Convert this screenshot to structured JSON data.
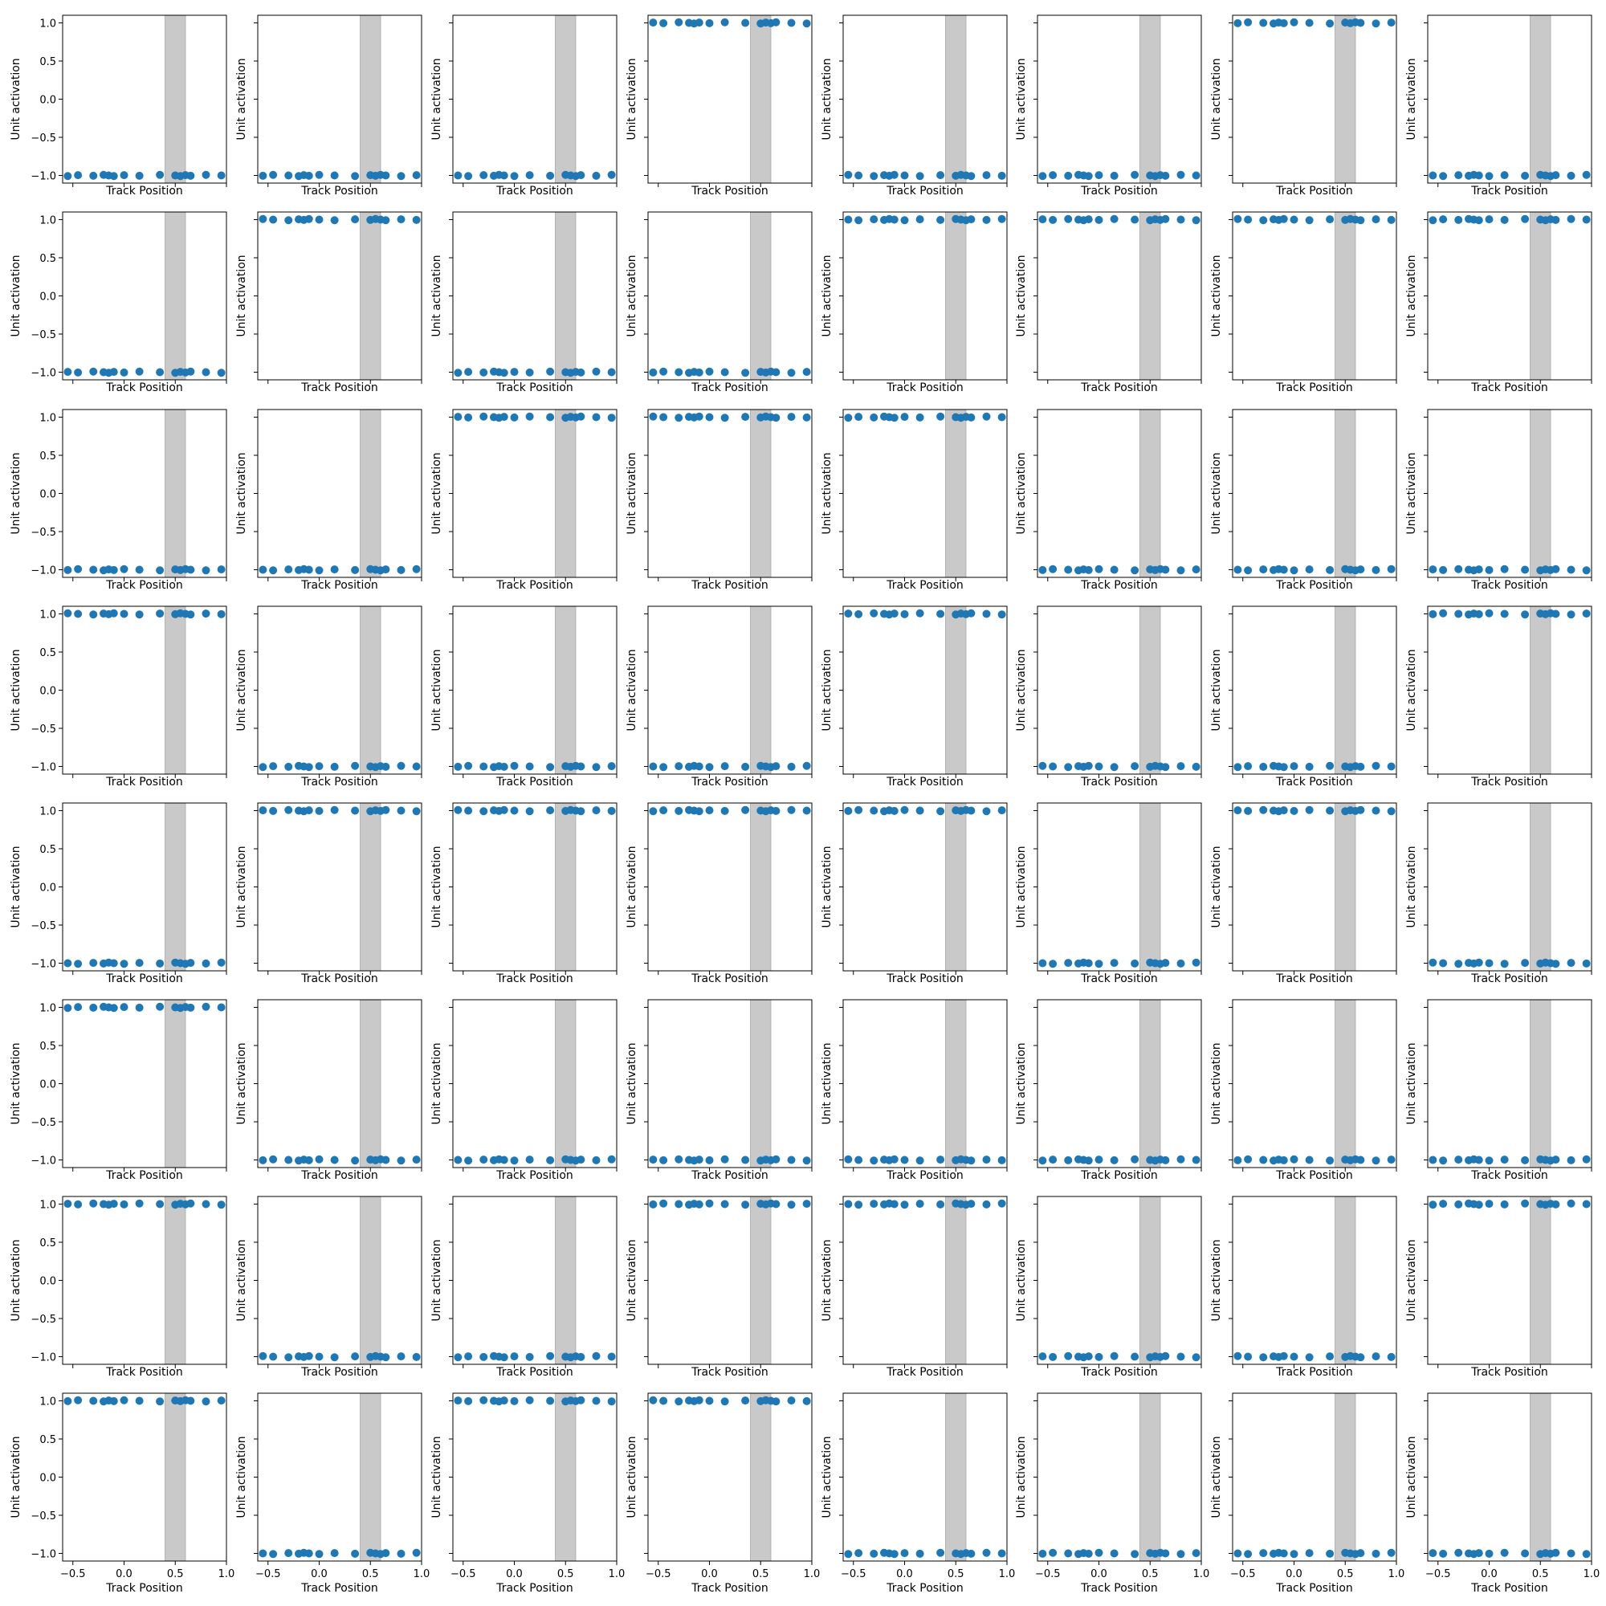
{
  "chart_data": {
    "type": "scatter",
    "layout": {
      "rows": 8,
      "cols": 8,
      "sharex": true,
      "sharey": true
    },
    "xlabel": "Track Position",
    "ylabel": "Unit activation",
    "xlim": [
      -0.6,
      1.0
    ],
    "ylim": [
      -1.1,
      1.1
    ],
    "xticks": [
      -0.5,
      0.0,
      0.5,
      1.0
    ],
    "xtick_labels": [
      "−0.5",
      "0.0",
      "0.5",
      "1.0"
    ],
    "yticks": [
      1.0,
      0.5,
      0.0,
      -0.5,
      -1.0
    ],
    "ytick_labels": [
      "1.0",
      "0.5",
      "0.0",
      "−0.5",
      "−1.0"
    ],
    "shaded_region": {
      "x_range": [
        0.4,
        0.6
      ],
      "color": "#c9c9c9"
    },
    "marker_color": "#1f77b4",
    "track_positions": [
      -0.55,
      -0.45,
      -0.3,
      -0.2,
      -0.15,
      -0.1,
      0.0,
      0.15,
      0.35,
      0.5,
      0.55,
      0.6,
      0.65,
      0.8,
      0.95
    ],
    "panel_levels": [
      [
        -1,
        -1,
        -1,
        1,
        -1,
        -1,
        1,
        -1
      ],
      [
        -1,
        1,
        -1,
        -1,
        1,
        1,
        1,
        1
      ],
      [
        -1,
        -1,
        1,
        1,
        1,
        -1,
        -1,
        -1
      ],
      [
        1,
        -1,
        -1,
        -1,
        1,
        -1,
        -1,
        1
      ],
      [
        -1,
        1,
        1,
        1,
        1,
        -1,
        1,
        -1
      ],
      [
        1,
        -1,
        -1,
        -1,
        -1,
        -1,
        -1,
        -1
      ],
      [
        1,
        -1,
        -1,
        1,
        1,
        -1,
        -1,
        1
      ],
      [
        1,
        -1,
        1,
        1,
        -1,
        -1,
        -1,
        -1
      ]
    ]
  }
}
